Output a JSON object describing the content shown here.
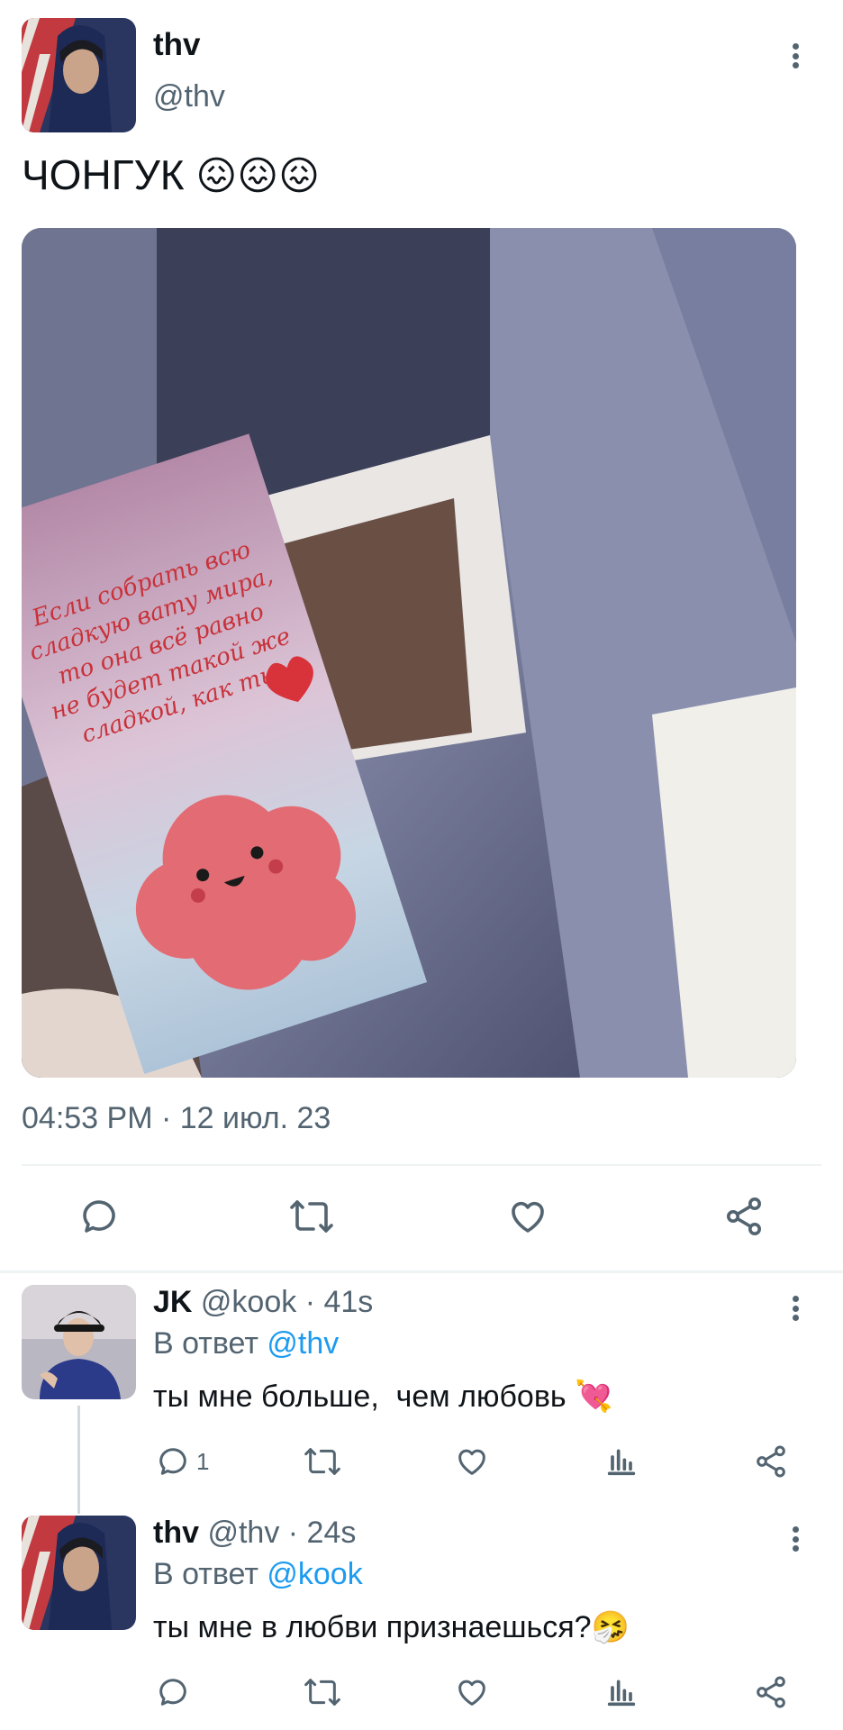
{
  "main_tweet": {
    "author_name": "thv",
    "author_handle": "@thv",
    "text": "ЧОНГУК",
    "emoji": [
      "😖",
      "😖",
      "😖"
    ],
    "image_card_text": "Если собрать всю сладкую вату мира, то она всё равно не будет такой же сладкой, как ты",
    "timestamp": "04:53 PM · 12 июл. 23",
    "actions": [
      "reply-icon",
      "retweet-icon",
      "like-icon",
      "share-icon"
    ]
  },
  "replies": [
    {
      "author_name": "JK",
      "author_handle": "@kook",
      "time": "· 41s",
      "reply_prefix": "В ответ",
      "reply_to": "@thv",
      "text": "ты мне больше,  чем любовь",
      "emoji": "💘",
      "reply_count": "1"
    },
    {
      "author_name": "thv",
      "author_handle": "@thv",
      "time": "· 24s",
      "reply_prefix": "В ответ",
      "reply_to": "@kook",
      "text": "ты мне в любви признаешься?",
      "emoji": "🤧",
      "reply_count": ""
    }
  ],
  "colors": {
    "accent": "#1d9bf0",
    "muted": "#536471",
    "divider": "#eff3f4"
  }
}
